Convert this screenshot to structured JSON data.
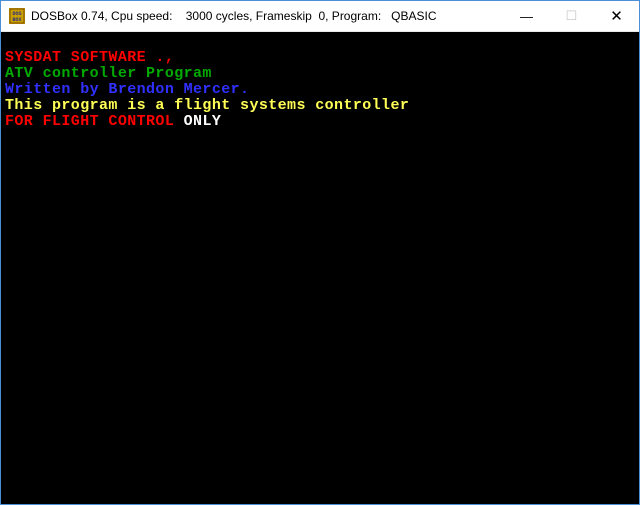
{
  "titlebar": {
    "text": "DOSBox 0.74, Cpu speed:    3000 cycles, Frameskip  0, Program:   QBASIC"
  },
  "window_controls": {
    "minimize": "—",
    "maximize": "☐",
    "close": "✕"
  },
  "console": {
    "line1": "SYSDAT SOFTWARE .,",
    "line2": "ATV controller Program",
    "line3": "Written by Brendon Mercer.",
    "line4": "This program is a flight systems controller",
    "line5a": "FOR FLIGHT CONTROL",
    "line5b": " ONLY"
  }
}
